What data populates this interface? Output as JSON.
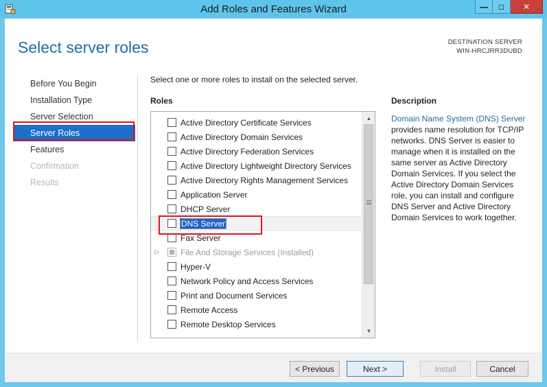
{
  "window": {
    "title": "Add Roles and Features Wizard",
    "minimize": "—",
    "maximize": "□",
    "close": "✕"
  },
  "page": {
    "title": "Select server roles",
    "destination_label": "DESTINATION SERVER",
    "destination_server": "WIN-HRCJRR3DUBD",
    "instruction": "Select one or more roles to install on the selected server.",
    "roles_heading": "Roles",
    "description_heading": "Description"
  },
  "nav": [
    {
      "label": "Before You Begin",
      "state": "normal"
    },
    {
      "label": "Installation Type",
      "state": "normal"
    },
    {
      "label": "Server Selection",
      "state": "normal"
    },
    {
      "label": "Server Roles",
      "state": "selected"
    },
    {
      "label": "Features",
      "state": "normal"
    },
    {
      "label": "Confirmation",
      "state": "disabled"
    },
    {
      "label": "Results",
      "state": "disabled"
    }
  ],
  "roles": [
    {
      "label": "Active Directory Certificate Services"
    },
    {
      "label": "Active Directory Domain Services"
    },
    {
      "label": "Active Directory Federation Services"
    },
    {
      "label": "Active Directory Lightweight Directory Services"
    },
    {
      "label": "Active Directory Rights Management Services"
    },
    {
      "label": "Application Server"
    },
    {
      "label": "DHCP Server"
    },
    {
      "label": "DNS Server"
    },
    {
      "label": "Fax Server"
    },
    {
      "label": "File And Storage Services (Installed)"
    },
    {
      "label": "Hyper-V"
    },
    {
      "label": "Network Policy and Access Services"
    },
    {
      "label": "Print and Document Services"
    },
    {
      "label": "Remote Access"
    },
    {
      "label": "Remote Desktop Services"
    }
  ],
  "description": {
    "link_text": "Domain Name System (DNS) Server",
    "body": " provides name resolution for TCP/IP networks. DNS Server is easier to manage when it is installed on the same server as Active Directory Domain Services. If you select the Active Directory Domain Services role, you can install and configure DNS Server and Active Directory Domain Services to work together."
  },
  "buttons": {
    "previous": "< Previous",
    "next": "Next >",
    "install": "Install",
    "cancel": "Cancel"
  },
  "colors": {
    "accent": "#1f6e9e",
    "selection": "#1b6fc8",
    "annotation": "#e3121d"
  }
}
